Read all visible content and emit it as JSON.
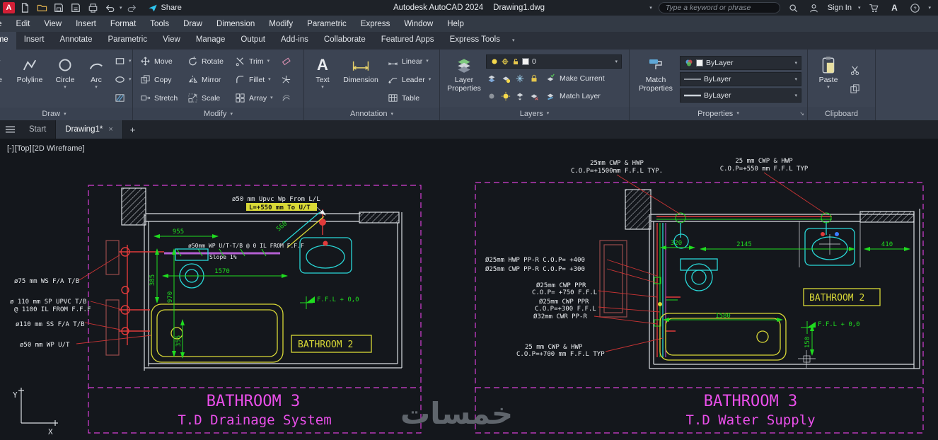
{
  "titlebar": {
    "app_title": "Autodesk AutoCAD 2024",
    "doc_title": "Drawing1.dwg",
    "share": "Share",
    "search_placeholder": "Type a keyword or phrase",
    "sign_in": "Sign In"
  },
  "menubar": {
    "items": [
      "File",
      "Edit",
      "View",
      "Insert",
      "Format",
      "Tools",
      "Draw",
      "Dimension",
      "Modify",
      "Parametric",
      "Express",
      "Window",
      "Help"
    ]
  },
  "ribbon": {
    "tabs": [
      "Home",
      "Insert",
      "Annotate",
      "Parametric",
      "View",
      "Manage",
      "Output",
      "Add-ins",
      "Collaborate",
      "Featured Apps",
      "Express Tools"
    ],
    "draw": {
      "label": "Draw",
      "line": "Line",
      "polyline": "Polyline",
      "circle": "Circle",
      "arc": "Arc"
    },
    "modify": {
      "label": "Modify",
      "move": "Move",
      "rotate": "Rotate",
      "trim": "Trim",
      "copy": "Copy",
      "mirror": "Mirror",
      "fillet": "Fillet",
      "stretch": "Stretch",
      "scale": "Scale",
      "array": "Array"
    },
    "annotation": {
      "label": "Annotation",
      "text": "Text",
      "dimension": "Dimension",
      "linear": "Linear",
      "leader": "Leader",
      "table": "Table"
    },
    "layers": {
      "label": "Layers",
      "layer_properties": "Layer Properties",
      "make_current": "Make Current",
      "match_layer": "Match Layer",
      "current_layer": "0"
    },
    "properties": {
      "label": "Properties",
      "match_properties": "Match Properties",
      "color": "ByLayer",
      "linetype": "ByLayer",
      "lineweight": "ByLayer"
    },
    "clipboard": {
      "label": "Clipboard",
      "paste": "Paste"
    }
  },
  "file_tabs": {
    "start": "Start",
    "active": "Drawing1*",
    "close": "×",
    "new_tab": "+"
  },
  "viewport": {
    "minus": "[-]",
    "view": "[Top]",
    "visual_style": "[2D Wireframe]"
  },
  "ucs": {
    "x_label": "X",
    "y_label": "Y"
  },
  "watermark": "خمسات",
  "colors": {
    "magenta": "#ea4fea",
    "cyan": "#29d8d8",
    "yellow": "#d9d937",
    "green": "#1fdc1f",
    "red": "#e23b3b",
    "white": "#eceff2"
  },
  "left_drawing": {
    "title1": "BATHROOM 3",
    "title2": "T.D Drainage System",
    "room": "BATHROOM 2",
    "ffl": "F.F.L + 0,0",
    "top_label": "ø50 mm Upvc Wp From L/L",
    "top_highlight": "L=+550 mm To U/T",
    "pipe_label": "ø50mm WP U/T-T/B @ 0 IL FROM F.F.F",
    "slope": "Slope 1%",
    "side_labels": [
      "ø75 mm WS F/A T/B",
      "ø 110 mm SP UPVC T/B",
      "@ 1100 IL FROM F.F.F",
      "ø110 mm SS F/A T/B",
      "ø50 mm WP U/T"
    ],
    "dims": {
      "d955": "955",
      "d385": "385",
      "d970": "970",
      "d355": "355",
      "d560": "560",
      "d1570": "1570"
    }
  },
  "right_drawing": {
    "title1": "BATHROOM 3",
    "title2": "T.D Water Supply",
    "room": "BATHROOM 2",
    "ffl": "F.F.L + 0,0",
    "top_label1a": "25mm CWP & HWP",
    "top_label1b": "C.O.P=+1500mm F.F.L TYP.",
    "top_label2a": "25 mm CWP & HWP",
    "top_label2b": "C.O.P=+550 mm F.F.L TYP",
    "left_labels": [
      "Ø25mm HWP PP-R C.O.P= +400",
      "Ø25mm CWP PP-R C.O.P= +300",
      "Ø25mm CWP PPR",
      "C.O.P= +750 F.F.L",
      "Ø25mm CWP PPR",
      "C.O.P=+300 F.F.L",
      "Ø32mm CWR PP-R",
      "25 mm CWP & HWP",
      "C.O.P=+700 mm F.F.L TYP"
    ],
    "dims": {
      "d320": "320",
      "d2145": "2145",
      "d410": "410",
      "d1580": "1580",
      "d150": "150"
    }
  }
}
